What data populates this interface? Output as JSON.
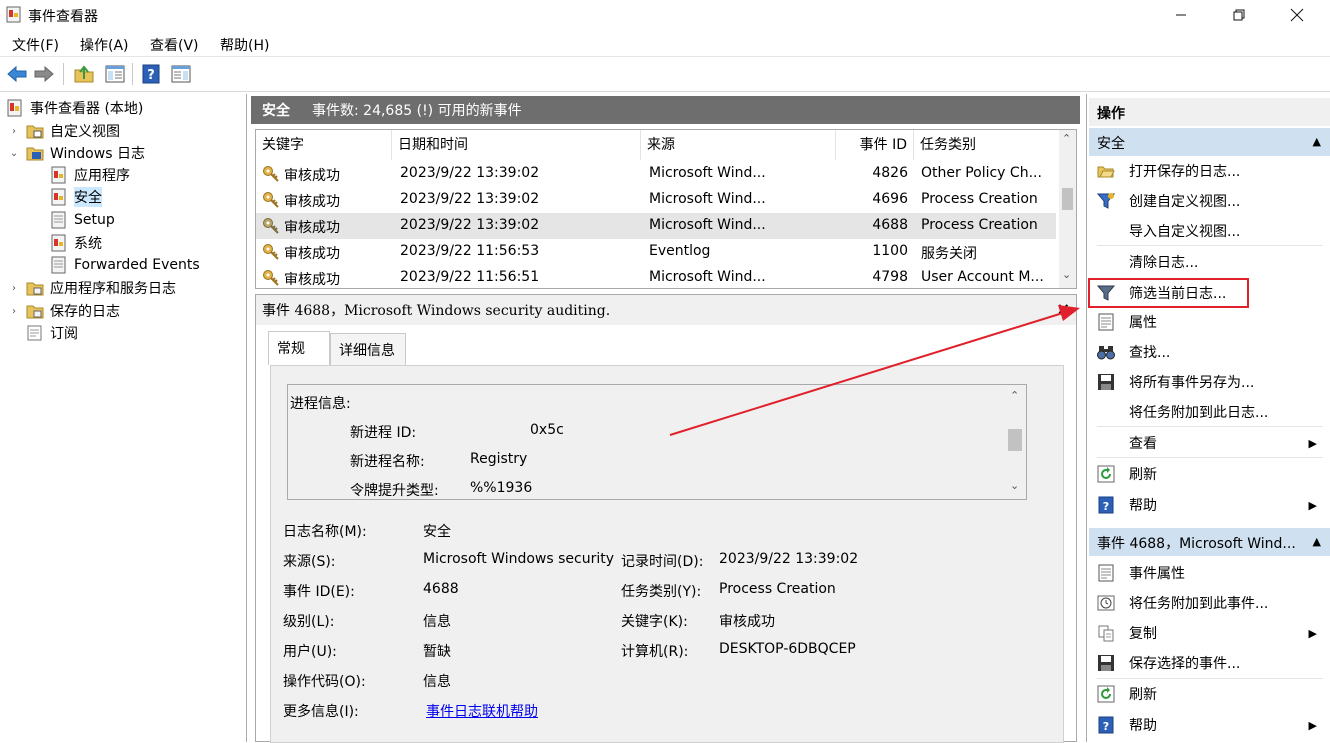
{
  "window": {
    "title": "事件查看器",
    "controls": {
      "minimize": "—",
      "maximize": "❐",
      "close": "✕"
    }
  },
  "menu": [
    "文件(F)",
    "操作(A)",
    "查看(V)",
    "帮助(H)"
  ],
  "toolbar": [
    "back-icon",
    "forward-icon",
    "folder-up-icon",
    "console-tree-icon",
    "help-icon",
    "action-pane-icon"
  ],
  "tree": {
    "root": "事件查看器 (本地)",
    "custom_views": "自定义视图",
    "windows_logs": "Windows 日志",
    "app_log": "应用程序",
    "security_log": "安全",
    "setup_log": "Setup",
    "system_log": "系统",
    "forwarded_log": "Forwarded Events",
    "app_service_logs": "应用程序和服务日志",
    "saved_logs": "保存的日志",
    "subscriptions": "订阅",
    "expanders": {
      "collapsed": "›",
      "expanded": "⌄"
    }
  },
  "center": {
    "header_title": "安全",
    "header_count": "事件数: 24,685 (!) 可用的新事件",
    "columns": [
      "关键字",
      "日期和时间",
      "来源",
      "事件 ID",
      "任务类别"
    ],
    "rows": [
      {
        "keyword": "审核成功",
        "datetime": "2023/9/22 13:39:02",
        "source": "Microsoft Wind...",
        "id": "4826",
        "task": "Other Policy Ch..."
      },
      {
        "keyword": "审核成功",
        "datetime": "2023/9/22 13:39:02",
        "source": "Microsoft Wind...",
        "id": "4696",
        "task": "Process Creation"
      },
      {
        "keyword": "审核成功",
        "datetime": "2023/9/22 13:39:02",
        "source": "Microsoft Wind...",
        "id": "4688",
        "task": "Process Creation"
      },
      {
        "keyword": "审核成功",
        "datetime": "2023/9/22 11:56:53",
        "source": "Eventlog",
        "id": "1100",
        "task": "服务关闭"
      },
      {
        "keyword": "审核成功",
        "datetime": "2023/9/22 11:56:51",
        "source": "Microsoft Wind...",
        "id": "4798",
        "task": "User Account M..."
      }
    ],
    "scroll": {
      "up": "⌃",
      "down": "⌄"
    }
  },
  "detail": {
    "title": "事件 4688，Microsoft Windows security auditing.",
    "close": "×",
    "tabs": [
      "常规",
      "详细信息"
    ],
    "description": {
      "section": "进程信息:",
      "new_pid_label": "新进程 ID:",
      "new_pid_value": "0x5c",
      "new_name_label": "新进程名称:",
      "new_name_value": "Registry",
      "token_label": "令牌提升类型:",
      "token_value": "%%1936"
    },
    "fields": {
      "log_name_label": "日志名称(M):",
      "log_name": "安全",
      "source_label": "来源(S):",
      "source": "Microsoft Windows security",
      "logged_label": "记录时间(D):",
      "logged": "2023/9/22 13:39:02",
      "event_id_label": "事件 ID(E):",
      "event_id": "4688",
      "task_label": "任务类别(Y):",
      "task": "Process Creation",
      "level_label": "级别(L):",
      "level": "信息",
      "keywords_label": "关键字(K):",
      "keywords": "审核成功",
      "user_label": "用户(U):",
      "user": "暂缺",
      "computer_label": "计算机(R):",
      "computer": "DESKTOP-6DBQCEP",
      "opcode_label": "操作代码(O):",
      "opcode": "信息",
      "more_info_label": "更多信息(I):",
      "more_info": "事件日志联机帮助"
    }
  },
  "actions": {
    "header": "操作",
    "section1": "安全",
    "section1_items": {
      "open_saved": "打开保存的日志...",
      "create_view": "创建自定义视图...",
      "import_view": "导入自定义视图...",
      "clear_log": "清除日志...",
      "filter_log": "筛选当前日志...",
      "properties": "属性",
      "find": "查找...",
      "save_all": "将所有事件另存为...",
      "attach_task_log": "将任务附加到此日志...",
      "view": "查看",
      "refresh": "刷新",
      "help": "帮助"
    },
    "section2": "事件 4688，Microsoft Wind...",
    "section2_items": {
      "event_props": "事件属性",
      "attach_task_event": "将任务附加到此事件...",
      "copy": "复制",
      "save_selected": "保存选择的事件...",
      "refresh": "刷新",
      "help": "帮助"
    },
    "collapse_glyph": "▲",
    "submenu_glyph": "▶"
  },
  "colors": {
    "highlight_box": "#e0202a",
    "annotation_arrow": "#e0202a",
    "header_bg": "#6e6e6e",
    "section_bg": "#cfe0f1"
  }
}
